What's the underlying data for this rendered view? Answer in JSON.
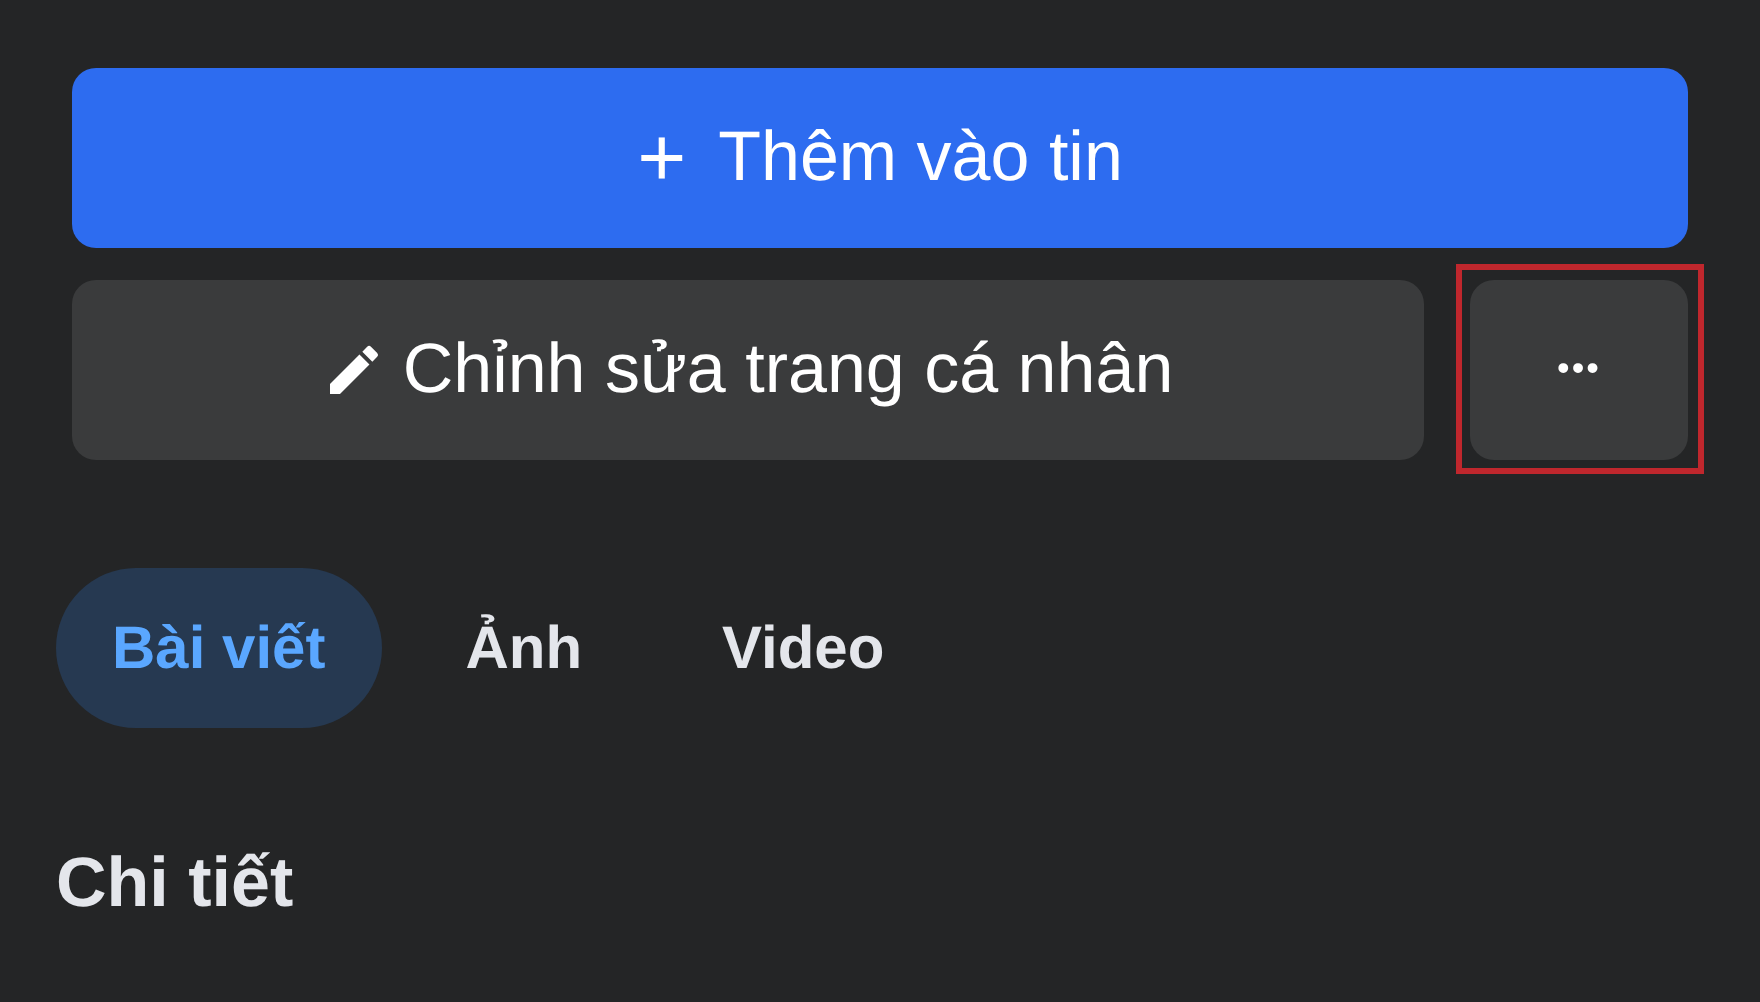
{
  "add_story_button": {
    "icon": "+",
    "label": "Thêm vào tin"
  },
  "edit_profile_button": {
    "label": "Chỉnh sửa trang cá nhân"
  },
  "more_button": {
    "label": "•••",
    "highlighted": true
  },
  "tabs": [
    {
      "label": "Bài viết",
      "selected": true
    },
    {
      "label": "Ảnh",
      "selected": false
    },
    {
      "label": "Video",
      "selected": false
    }
  ],
  "section_title": "Chi tiết"
}
